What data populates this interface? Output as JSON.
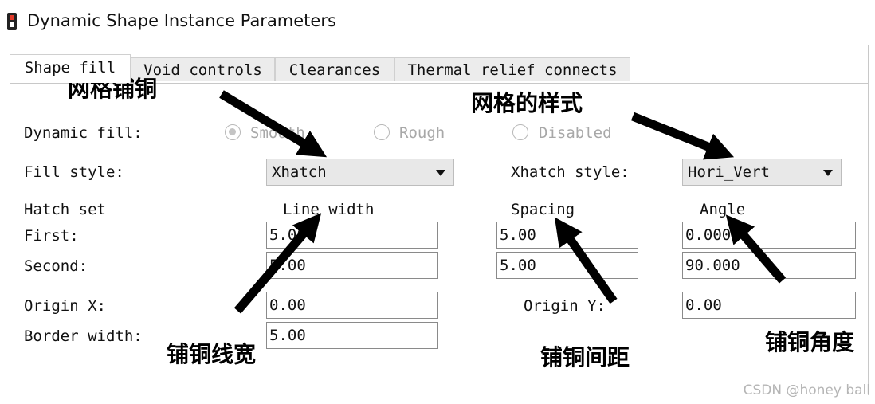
{
  "window": {
    "title": "Dynamic Shape Instance Parameters"
  },
  "tabs": [
    {
      "label": "Shape fill",
      "active": true
    },
    {
      "label": "Void controls"
    },
    {
      "label": "Clearances"
    },
    {
      "label": "Thermal relief connects"
    }
  ],
  "dynamic_fill": {
    "label": "Dynamic fill:",
    "options": [
      "Smooth",
      "Rough",
      "Disabled"
    ],
    "selected": "Smooth"
  },
  "fill_style": {
    "label": "Fill style:",
    "value": "Xhatch"
  },
  "xhatch_style": {
    "label": "Xhatch style:",
    "value": "Hori_Vert"
  },
  "hatch_set": {
    "label": "Hatch set",
    "columns": [
      "Line width",
      "Spacing",
      "Angle"
    ],
    "rows": [
      {
        "label": "First:",
        "line_width": "5.00",
        "spacing": "5.00",
        "angle": "0.000"
      },
      {
        "label": "Second:",
        "line_width": "5.00",
        "spacing": "5.00",
        "angle": "90.000"
      }
    ]
  },
  "origin_x": {
    "label": "Origin X:",
    "value": "0.00"
  },
  "origin_y": {
    "label": "Origin Y:",
    "value": "0.00"
  },
  "border_width": {
    "label": "Border width:",
    "value": "5.00"
  },
  "annotations": {
    "grid_copper": "网格铺铜",
    "grid_style": "网格的样式",
    "copper_line_width": "铺铜线宽",
    "copper_spacing": "铺铜间距",
    "copper_angle": "铺铜角度"
  },
  "watermark": "CSDN @honey ball"
}
